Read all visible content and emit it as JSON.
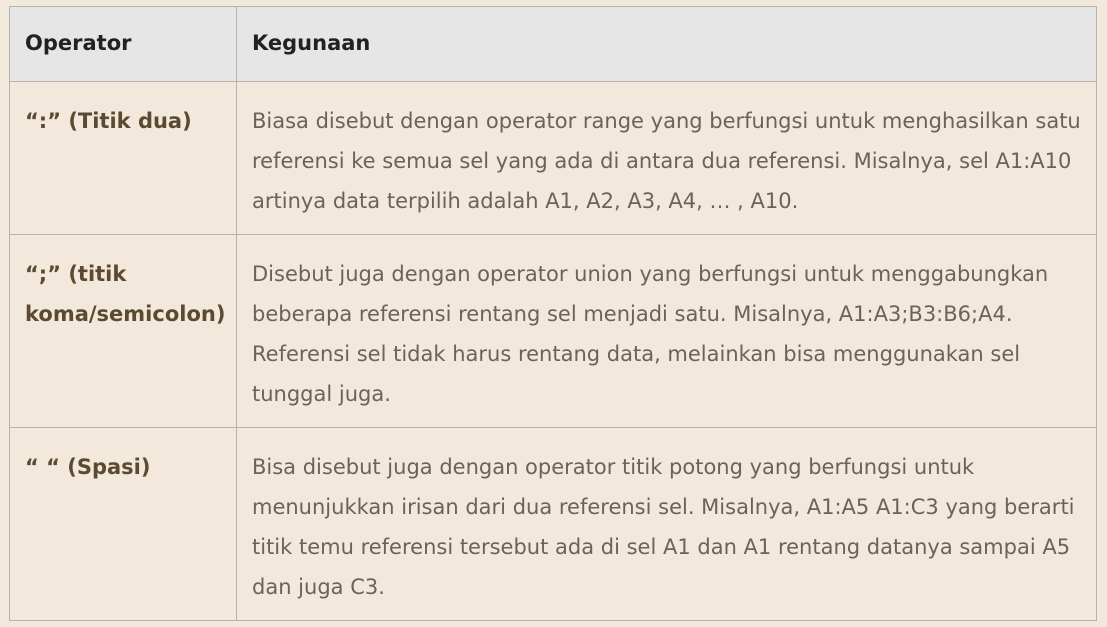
{
  "table": {
    "headers": [
      "Operator",
      "Kegunaan"
    ],
    "rows": [
      {
        "operator": "“:” (Titik dua)",
        "description": "Biasa disebut dengan operator range yang berfungsi untuk menghasilkan satu referensi ke semua sel yang ada di antara dua referensi. Misalnya, sel A1:A10 artinya data terpilih adalah A1, A2, A3, A4, … , A10."
      },
      {
        "operator": "“;” (titik koma/semicolon)",
        "description": "Disebut juga dengan operator union yang berfungsi untuk menggabungkan beberapa referensi rentang sel menjadi satu. Misalnya, A1:A3;B3:B6;A4. Referensi sel tidak harus rentang data, melainkan bisa menggunakan sel tunggal juga."
      },
      {
        "operator": "“ “ (Spasi)",
        "description": "Bisa disebut juga dengan operator titik potong yang berfungsi untuk menunjukkan irisan dari dua referensi sel. Misalnya, A1:A5 A1:C3 yang berarti titik temu referensi tersebut ada di sel A1 dan A1 rentang datanya sampai A5 dan juga C3."
      }
    ]
  }
}
